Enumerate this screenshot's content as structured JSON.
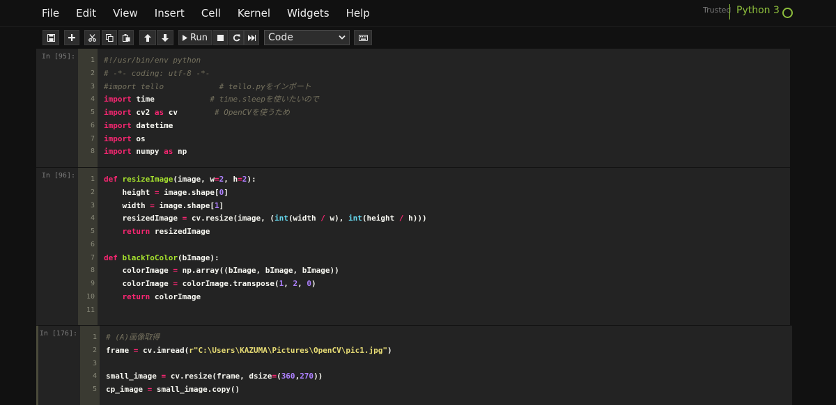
{
  "menu": [
    "File",
    "Edit",
    "View",
    "Insert",
    "Cell",
    "Kernel",
    "Widgets",
    "Help"
  ],
  "kernel": {
    "trusted": "Trusted",
    "name": "Python 3"
  },
  "toolbar": {
    "run_label": "Run",
    "cell_type": "Code"
  },
  "icons": [
    "save-icon",
    "plus-icon",
    "scissors-icon",
    "copy-icon",
    "paste-icon",
    "arrow-up-icon",
    "arrow-down-icon",
    "play-icon",
    "stop-icon",
    "restart-icon",
    "fast-forward-icon",
    "keyboard-icon"
  ],
  "cells": [
    {
      "prompt": "In [95]:",
      "lines": [
        [
          [
            "com",
            "#!/usr/bin/env python"
          ]
        ],
        [
          [
            "com",
            "# -*- coding: utf-8 -*-"
          ]
        ],
        [
          [
            "com",
            "#import tello            # tello.pyをインポート"
          ]
        ],
        [
          [
            "kw",
            "import"
          ],
          [
            "t",
            " time            "
          ],
          [
            "com",
            "# time.sleepを使いたいので"
          ]
        ],
        [
          [
            "kw",
            "import"
          ],
          [
            "t",
            " cv2 "
          ],
          [
            "kw",
            "as"
          ],
          [
            "t",
            " cv        "
          ],
          [
            "com",
            "# OpenCVを使うため"
          ]
        ],
        [
          [
            "kw",
            "import"
          ],
          [
            "t",
            " datetime"
          ]
        ],
        [
          [
            "kw",
            "import"
          ],
          [
            "t",
            " os"
          ]
        ],
        [
          [
            "kw",
            "import"
          ],
          [
            "t",
            " numpy "
          ],
          [
            "kw",
            "as"
          ],
          [
            "t",
            " np"
          ]
        ]
      ]
    },
    {
      "prompt": "In [96]:",
      "lines": [
        [
          [
            "kw",
            "def"
          ],
          [
            "t",
            " "
          ],
          [
            "fn",
            "resizeImage"
          ],
          [
            "t",
            "(image, w"
          ],
          [
            "op",
            "="
          ],
          [
            "num",
            "2"
          ],
          [
            "t",
            ", h"
          ],
          [
            "op",
            "="
          ],
          [
            "num",
            "2"
          ],
          [
            "t",
            "):"
          ]
        ],
        [
          [
            "t",
            "    height "
          ],
          [
            "op",
            "="
          ],
          [
            "t",
            " image.shape["
          ],
          [
            "num",
            "0"
          ],
          [
            "t",
            "]"
          ]
        ],
        [
          [
            "t",
            "    width "
          ],
          [
            "op",
            "="
          ],
          [
            "t",
            " image.shape["
          ],
          [
            "num",
            "1"
          ],
          [
            "t",
            "]"
          ]
        ],
        [
          [
            "t",
            "    resizedImage "
          ],
          [
            "op",
            "="
          ],
          [
            "t",
            " cv.resize(image, ("
          ],
          [
            "bi",
            "int"
          ],
          [
            "t",
            "(width "
          ],
          [
            "op",
            "/"
          ],
          [
            "t",
            " w), "
          ],
          [
            "bi",
            "int"
          ],
          [
            "t",
            "(height "
          ],
          [
            "op",
            "/"
          ],
          [
            "t",
            " h)))"
          ]
        ],
        [
          [
            "t",
            "    "
          ],
          [
            "kw",
            "return"
          ],
          [
            "t",
            " resizedImage"
          ]
        ],
        [
          [
            "t",
            ""
          ]
        ],
        [
          [
            "kw",
            "def"
          ],
          [
            "t",
            " "
          ],
          [
            "fn",
            "blackToColor"
          ],
          [
            "t",
            "(bImage):"
          ]
        ],
        [
          [
            "t",
            "    colorImage "
          ],
          [
            "op",
            "="
          ],
          [
            "t",
            " np.array((bImage, bImage, bImage))"
          ]
        ],
        [
          [
            "t",
            "    colorImage "
          ],
          [
            "op",
            "="
          ],
          [
            "t",
            " colorImage.transpose("
          ],
          [
            "num",
            "1"
          ],
          [
            "t",
            ", "
          ],
          [
            "num",
            "2"
          ],
          [
            "t",
            ", "
          ],
          [
            "num",
            "0"
          ],
          [
            "t",
            ")"
          ]
        ],
        [
          [
            "t",
            "    "
          ],
          [
            "kw",
            "return"
          ],
          [
            "t",
            " colorImage"
          ]
        ],
        [
          [
            "t",
            ""
          ]
        ]
      ]
    },
    {
      "prompt": "In [176]:",
      "lines": [
        [
          [
            "com",
            "# (A)画像取得"
          ]
        ],
        [
          [
            "t",
            "frame "
          ],
          [
            "op",
            "="
          ],
          [
            "t",
            " cv.imread("
          ],
          [
            "str",
            "r\"C:\\Users\\KAZUMA\\Pictures\\OpenCV\\pic1.jpg\""
          ],
          [
            "t",
            ")"
          ]
        ],
        [
          [
            "t",
            ""
          ]
        ],
        [
          [
            "t",
            "small_image "
          ],
          [
            "op",
            "="
          ],
          [
            "t",
            " cv.resize(frame, dsize"
          ],
          [
            "op",
            "="
          ],
          [
            "t",
            "("
          ],
          [
            "num",
            "360"
          ],
          [
            "t",
            ","
          ],
          [
            "num",
            "270"
          ],
          [
            "t",
            "))"
          ]
        ],
        [
          [
            "t",
            "cp_image "
          ],
          [
            "op",
            "="
          ],
          [
            "t",
            " small_image.copy()"
          ]
        ]
      ]
    }
  ]
}
